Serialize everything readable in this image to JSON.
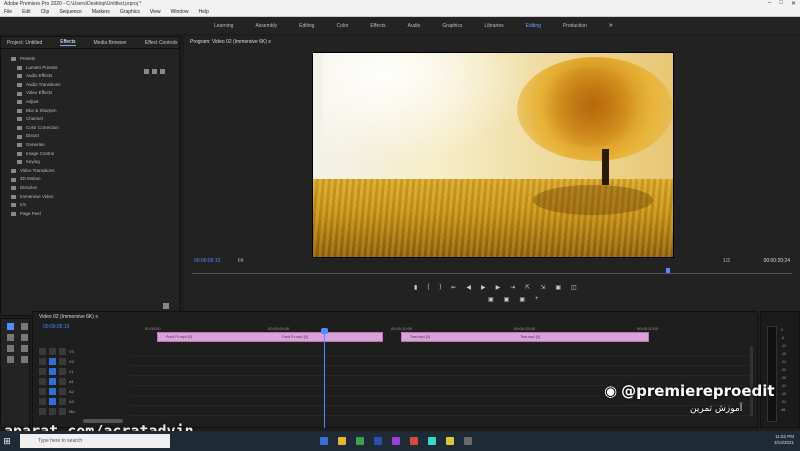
{
  "window": {
    "title": "Adobe Premiere Pro 2020 - C:\\Users\\Desktop\\Untitled.prproj *"
  },
  "menu": [
    "File",
    "Edit",
    "Clip",
    "Sequence",
    "Markers",
    "Graphics",
    "View",
    "Window",
    "Help"
  ],
  "workspaces": {
    "items": [
      "Learning",
      "Assembly",
      "Editing",
      "Color",
      "Effects",
      "Audio",
      "Graphics",
      "Libraries",
      "Editing",
      "Production"
    ],
    "active_index": 8
  },
  "effects_panel": {
    "tabs": [
      "Project: Untitled",
      "Effects",
      "Media Browser",
      "Effect Controls"
    ],
    "selected_tab": 1,
    "tree": [
      {
        "label": "Presets",
        "level": 0
      },
      {
        "label": "Lumetri Presets",
        "level": 1
      },
      {
        "label": "Audio Effects",
        "level": 1
      },
      {
        "label": "Audio Transitions",
        "level": 1
      },
      {
        "label": "Video Effects",
        "level": 1
      },
      {
        "label": "Adjust",
        "level": 1
      },
      {
        "label": "Blur & Sharpen",
        "level": 1
      },
      {
        "label": "Channel",
        "level": 1
      },
      {
        "label": "Color Correction",
        "level": 1
      },
      {
        "label": "Distort",
        "level": 1
      },
      {
        "label": "Generate",
        "level": 1
      },
      {
        "label": "Image Control",
        "level": 1
      },
      {
        "label": "Keying",
        "level": 1
      },
      {
        "label": "Video Transitions",
        "level": 0
      },
      {
        "label": "3D Motion",
        "level": 0
      },
      {
        "label": "Dissolve",
        "level": 0
      },
      {
        "label": "Immersive Video",
        "level": 0
      },
      {
        "label": "Iris",
        "level": 0
      },
      {
        "label": "Page Peel",
        "level": 0
      }
    ]
  },
  "program_monitor": {
    "title": "Program: Video 02 (Immersive 6K) ≡",
    "timecode": "00:00:05:10",
    "zoom": "Fit",
    "resolution": "1/2",
    "duration": "00:00:20:24"
  },
  "timeline": {
    "title": "Video 02 (Immersive 6K) ≡",
    "timecode": "00:00:05:10",
    "ruler": [
      "00:00:00",
      "00:00:05:00",
      "00:00:10:00",
      "00:00:15:00",
      "00:00:20:00"
    ],
    "tracks": [
      "V3",
      "V2",
      "V1",
      "A1",
      "A2",
      "A3",
      "Mix"
    ],
    "clips": [
      {
        "label_a": "Pond Fx.mp4 [V]",
        "label_b": "Pond Fx.mp4 [V]"
      },
      {
        "label_a": "Tree.mp4 [V]",
        "label_b": "Tree.mp4 [V]"
      }
    ]
  },
  "meters": {
    "scale": [
      "0",
      "-6",
      "-12",
      "-18",
      "-24",
      "-30",
      "-36",
      "-42",
      "-48",
      "-54",
      "dB"
    ]
  },
  "overlays": {
    "instagram_handle": "@premiereproedit",
    "persian_text": "آموزش تمرین",
    "watermark": "aparat.com/acratadvin"
  },
  "taskbar": {
    "search_placeholder": "Type here to search",
    "time": "11:52 PM",
    "date": "3/13/2021"
  },
  "colors": {
    "accent_blue": "#4f8cff",
    "clip_pink": "#d9a2d8",
    "panel_bg": "#232323"
  }
}
